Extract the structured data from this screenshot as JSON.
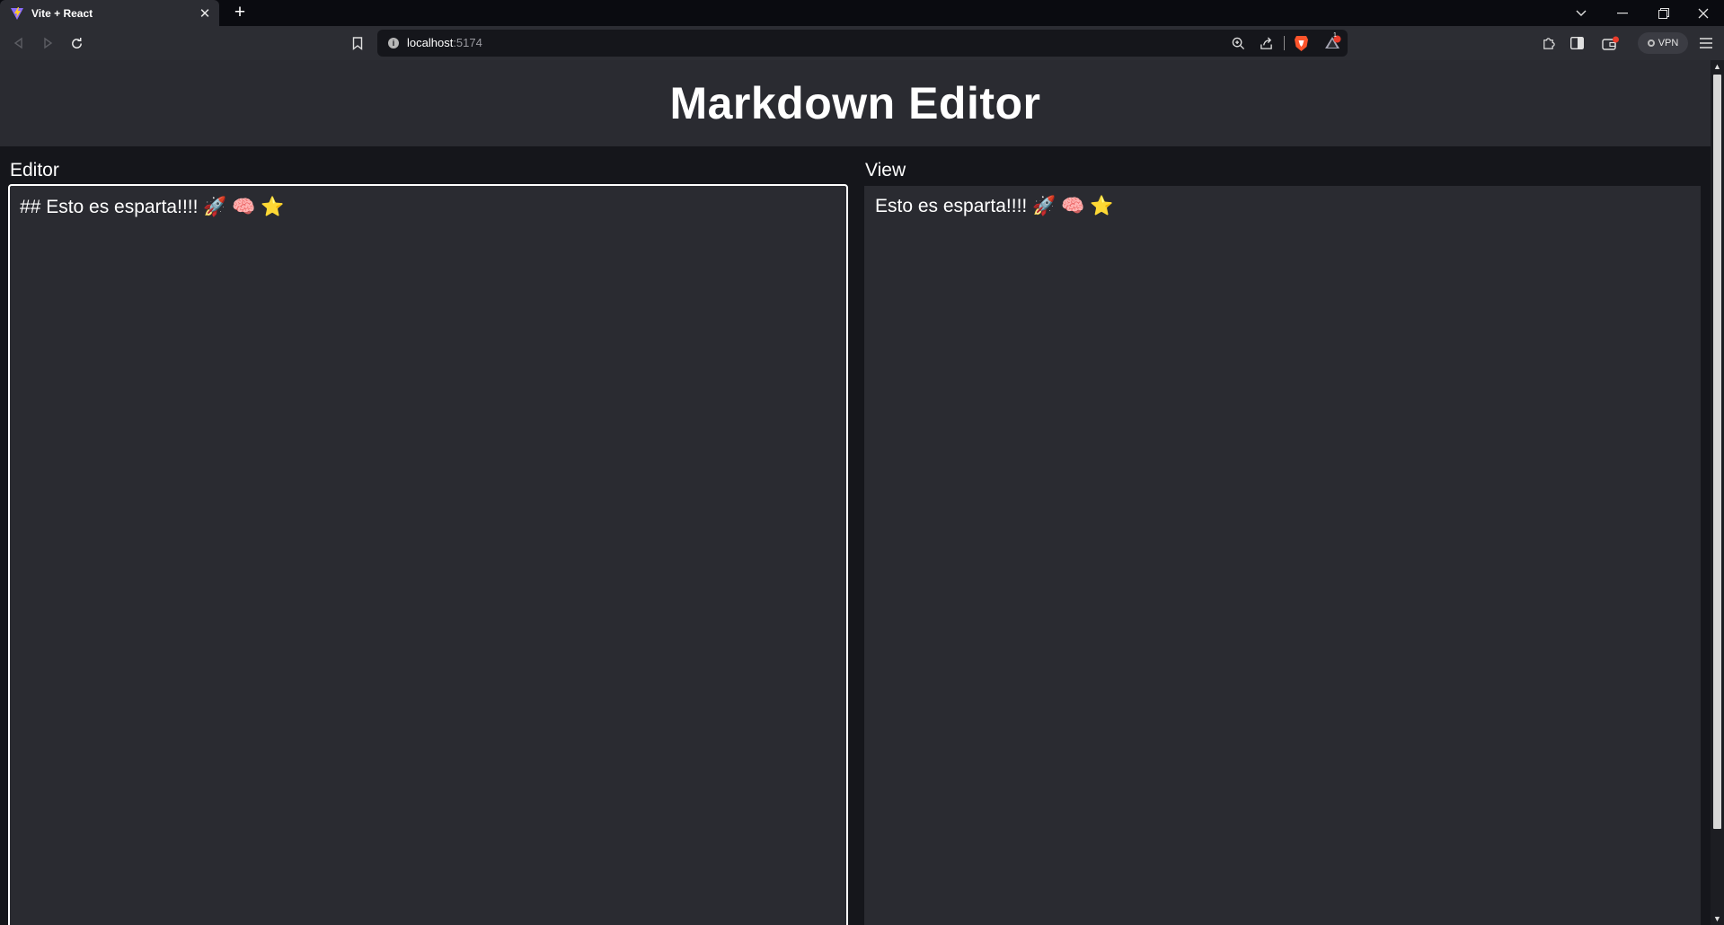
{
  "browser": {
    "tab_title": "Vite + React",
    "url_host": "localhost",
    "url_port": ":5174",
    "vpn_label": "VPN",
    "notification_count": "1"
  },
  "app": {
    "title": "Markdown Editor",
    "editor_label": "Editor",
    "view_label": "View",
    "editor_text": "## Esto es esparta!!!! 🚀 🧠 ⭐",
    "view_text": "Esto es esparta!!!! 🚀 🧠 ⭐"
  },
  "colors": {
    "header_bg": "#2a2b31",
    "page_bg": "#15161b",
    "accent": "#ffffff"
  }
}
